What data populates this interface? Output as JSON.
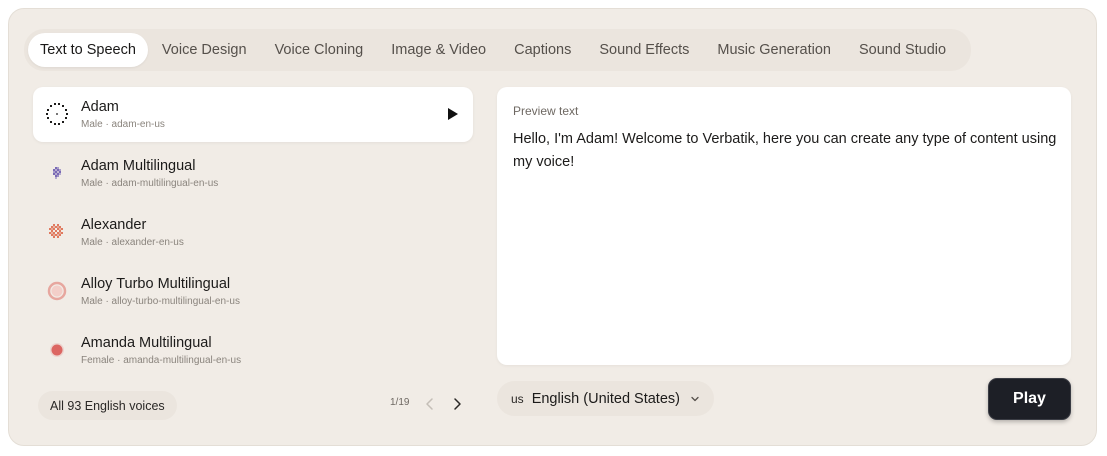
{
  "tabs": [
    {
      "label": "Text to Speech",
      "active": true
    },
    {
      "label": "Voice Design"
    },
    {
      "label": "Voice Cloning"
    },
    {
      "label": "Image & Video"
    },
    {
      "label": "Captions"
    },
    {
      "label": "Sound Effects"
    },
    {
      "label": "Music Generation"
    },
    {
      "label": "Sound Studio"
    }
  ],
  "voices": [
    {
      "name": "Adam",
      "meta": "Male · adam-en-us",
      "avatar": "dotted-ring-avatar",
      "active": true
    },
    {
      "name": "Adam Multilingual",
      "meta": "Male · adam-multilingual-en-us",
      "avatar": "purple-pixel-avatar",
      "color": "#7a6ab5"
    },
    {
      "name": "Alexander",
      "meta": "Male · alexander-en-us",
      "avatar": "orange-pixel-avatar",
      "color": "#e07a5f"
    },
    {
      "name": "Alloy Turbo Multilingual",
      "meta": "Male · alloy-turbo-multilingual-en-us",
      "avatar": "pink-ring-avatar",
      "color": "#e7a79f"
    },
    {
      "name": "Amanda Multilingual",
      "meta": "Female · amanda-multilingual-en-us",
      "avatar": "red-dot-avatar",
      "color": "#d9534f"
    }
  ],
  "list_footer": {
    "all_voices_label": "All 93 English voices",
    "page_indicator": "1/19"
  },
  "preview": {
    "label": "Preview text",
    "text": "Hello, I'm Adam! Welcome to Verbatik, here you can create any type of content using my voice!"
  },
  "language": {
    "flag": "us",
    "label": "English (United States)"
  },
  "play_button": {
    "label": "Play"
  },
  "colors": {
    "panel_bg": "#f1ece6",
    "play_button_bg": "#1d1f26"
  }
}
